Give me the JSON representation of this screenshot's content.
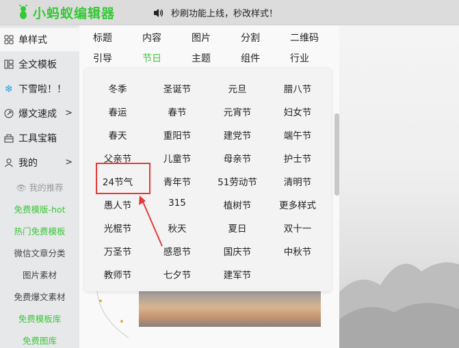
{
  "header": {
    "logo_text": "小蚂蚁编辑器",
    "notice": "秒刷功能上线，秒改样式！"
  },
  "sidebar": {
    "items": [
      {
        "label": "单样式",
        "icon": "grid-icon",
        "active": true
      },
      {
        "label": "全文模板",
        "icon": "template-icon"
      },
      {
        "label": "下雪啦！！",
        "icon": "snowflake-icon"
      },
      {
        "label": "爆文速成",
        "icon": "rocket-icon",
        "chevron": ">"
      },
      {
        "label": "工具宝箱",
        "icon": "toolbox-icon"
      },
      {
        "label": "我的",
        "icon": "user-icon",
        "chevron": ">"
      }
    ],
    "sub_items": [
      {
        "label": "我的推荐",
        "color": "#9a9a9a"
      },
      {
        "label": "免费模版-hot",
        "color": "#3cc63c"
      },
      {
        "label": "热门免费模板",
        "color": "#3cc63c"
      },
      {
        "label": "微信文章分类",
        "color": "#444444"
      },
      {
        "label": "图片素材",
        "color": "#444444"
      },
      {
        "label": "免费爆文素材",
        "color": "#444444"
      },
      {
        "label": "免费模板库",
        "color": "#3cc63c"
      },
      {
        "label": "免费图库",
        "color": "#3cc63c"
      }
    ]
  },
  "tabs": {
    "row1": [
      "标题",
      "内容",
      "图片",
      "分割",
      "二维码"
    ],
    "row2": [
      "引导",
      "节日",
      "主题",
      "组件",
      "行业"
    ],
    "active": "节日"
  },
  "holiday_grid": [
    [
      "冬季",
      "圣诞节",
      "元旦",
      "腊八节"
    ],
    [
      "春运",
      "春节",
      "元宵节",
      "妇女节"
    ],
    [
      "春天",
      "重阳节",
      "建党节",
      "端午节"
    ],
    [
      "父亲节",
      "儿童节",
      "母亲节",
      "护士节"
    ],
    [
      "24节气",
      "青年节",
      "51劳动节",
      "清明节"
    ],
    [
      "愚人节",
      "315",
      "植树节",
      "更多样式"
    ],
    [
      "光棍节",
      "秋天",
      "夏日",
      "双十一"
    ],
    [
      "万圣节",
      "感恩节",
      "国庆节",
      "中秋节"
    ],
    [
      "教师节",
      "七夕节",
      "建军节"
    ]
  ],
  "colors": {
    "accent": "#3cc63c",
    "highlight": "#e53935"
  }
}
